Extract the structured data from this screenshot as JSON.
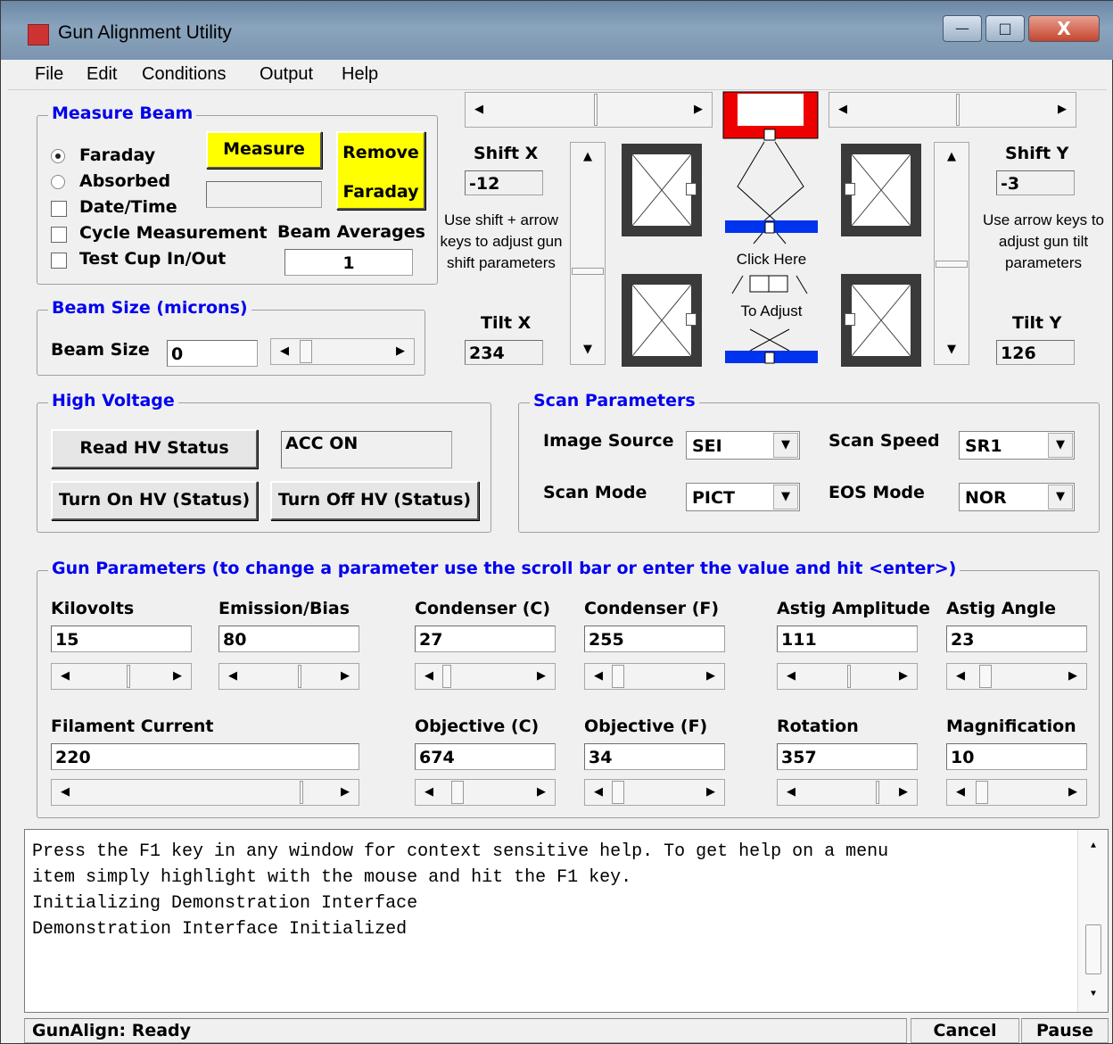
{
  "window": {
    "title": "Gun Alignment Utility"
  },
  "menu": [
    "File",
    "Edit",
    "Conditions",
    "Output",
    "Help"
  ],
  "measure_beam": {
    "legend": "Measure Beam",
    "options": [
      "Faraday",
      "Absorbed"
    ],
    "selected": "Faraday",
    "checkboxes": [
      "Date/Time",
      "Cycle Measurement",
      "Test Cup In/Out"
    ],
    "measure_button": "Measure",
    "remove_label": "Remove",
    "faraday_label": "Faraday",
    "averages_label": "Beam Averages",
    "averages_value": "1",
    "readout": ""
  },
  "beam_size": {
    "legend": "Beam Size (microns)",
    "label": "Beam Size",
    "value": "0"
  },
  "alignment": {
    "shift_x_label": "Shift X",
    "shift_x": "-12",
    "shift_y_label": "Shift Y",
    "shift_y": "-3",
    "tilt_x_label": "Tilt X",
    "tilt_x": "234",
    "tilt_y_label": "Tilt Y",
    "tilt_y": "126",
    "shift_note": "Use shift + arrow keys to adjust gun shift parameters",
    "tilt_note": "Use arrow keys to adjust gun tilt parameters",
    "click_here": "Click Here",
    "to_adjust": "To Adjust"
  },
  "high_voltage": {
    "legend": "High Voltage",
    "read_button": "Read HV Status",
    "status": "ACC ON",
    "on_button": "Turn On HV (Status)",
    "off_button": "Turn Off HV (Status)"
  },
  "scan": {
    "legend": "Scan Parameters",
    "image_source_label": "Image Source",
    "image_source": "SEI",
    "scan_speed_label": "Scan Speed",
    "scan_speed": "SR1",
    "scan_mode_label": "Scan Mode",
    "scan_mode": "PICT",
    "eos_mode_label": "EOS Mode",
    "eos_mode": "NOR"
  },
  "gun": {
    "legend": "Gun Parameters (to change a parameter use the scroll bar or enter the value and hit <enter>)",
    "kilovolts_label": "Kilovolts",
    "kilovolts": "15",
    "emission_label": "Emission/Bias",
    "emission": "80",
    "cond_c_label": "Condenser (C)",
    "cond_c": "27",
    "cond_f_label": "Condenser (F)",
    "cond_f": "255",
    "astig_amp_label": "Astig Amplitude",
    "astig_amp": "111",
    "astig_ang_label": "Astig Angle",
    "astig_ang": "23",
    "filament_label": "Filament Current",
    "filament": "220",
    "obj_c_label": "Objective (C)",
    "obj_c": "674",
    "obj_f_label": "Objective (F)",
    "obj_f": "34",
    "rotation_label": "Rotation",
    "rotation": "357",
    "magnification_label": "Magnification",
    "magnification": "10"
  },
  "console": {
    "lines": [
      "Press the F1 key in any window for context sensitive help. To get help on a menu",
      "item simply highlight with the mouse and hit the F1 key.",
      "",
      "Initializing Demonstration Interface",
      "Demonstration Interface Initialized"
    ]
  },
  "status": {
    "text": "GunAlign: Ready",
    "cancel": "Cancel",
    "pause": "Pause"
  },
  "colors": {
    "legend": "#0000ee",
    "measure": "#ffff00",
    "gun_red": "#ee0000",
    "lens_blue": "#0033ee"
  }
}
